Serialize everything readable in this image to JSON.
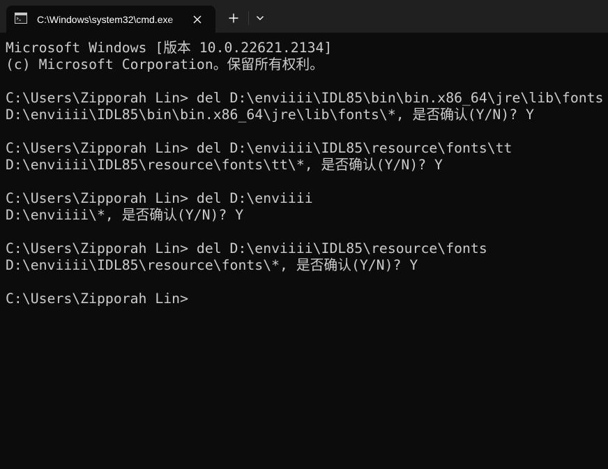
{
  "tab": {
    "title": "C:\\Windows\\system32\\cmd.exe",
    "icon": "cmd-icon",
    "close_icon": "close-icon"
  },
  "toolbar": {
    "new_tab_icon": "plus-icon",
    "dropdown_icon": "chevron-down-icon"
  },
  "colors": {
    "tabbar_bg": "#202020",
    "console_bg": "#0c0c0c",
    "text": "#cccccc",
    "tab_text": "#ffffff"
  },
  "console": {
    "lines": [
      "Microsoft Windows [版本 10.0.22621.2134]",
      "(c) Microsoft Corporation。保留所有权利。",
      "",
      "C:\\Users\\Zipporah Lin> del D:\\enviiii\\IDL85\\bin\\bin.x86_64\\jre\\lib\\fonts",
      "D:\\enviiii\\IDL85\\bin\\bin.x86_64\\jre\\lib\\fonts\\*, 是否确认(Y/N)? Y",
      "",
      "C:\\Users\\Zipporah Lin> del D:\\enviiii\\IDL85\\resource\\fonts\\tt",
      "D:\\enviiii\\IDL85\\resource\\fonts\\tt\\*, 是否确认(Y/N)? Y",
      "",
      "C:\\Users\\Zipporah Lin> del D:\\enviiii",
      "D:\\enviiii\\*, 是否确认(Y/N)? Y",
      "",
      "C:\\Users\\Zipporah Lin> del D:\\enviiii\\IDL85\\resource\\fonts",
      "D:\\enviiii\\IDL85\\resource\\fonts\\*, 是否确认(Y/N)? Y",
      "",
      "C:\\Users\\Zipporah Lin>"
    ]
  }
}
